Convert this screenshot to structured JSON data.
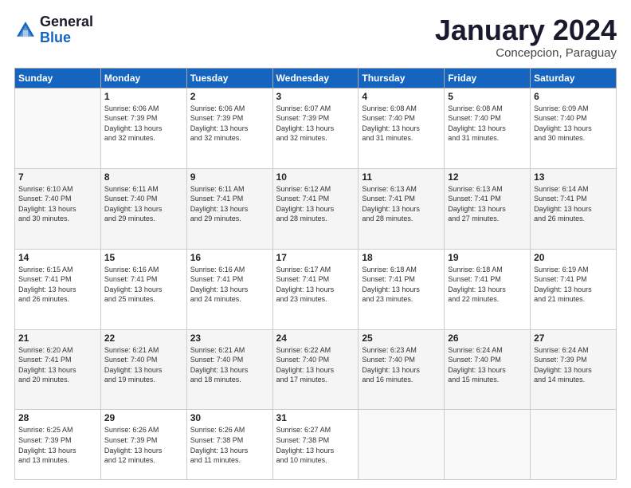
{
  "header": {
    "logo_general": "General",
    "logo_blue": "Blue",
    "title": "January 2024",
    "location": "Concepcion, Paraguay"
  },
  "days_header": [
    "Sunday",
    "Monday",
    "Tuesday",
    "Wednesday",
    "Thursday",
    "Friday",
    "Saturday"
  ],
  "weeks": [
    [
      {
        "day": "",
        "info": ""
      },
      {
        "day": "1",
        "info": "Sunrise: 6:06 AM\nSunset: 7:39 PM\nDaylight: 13 hours\nand 32 minutes."
      },
      {
        "day": "2",
        "info": "Sunrise: 6:06 AM\nSunset: 7:39 PM\nDaylight: 13 hours\nand 32 minutes."
      },
      {
        "day": "3",
        "info": "Sunrise: 6:07 AM\nSunset: 7:39 PM\nDaylight: 13 hours\nand 32 minutes."
      },
      {
        "day": "4",
        "info": "Sunrise: 6:08 AM\nSunset: 7:40 PM\nDaylight: 13 hours\nand 31 minutes."
      },
      {
        "day": "5",
        "info": "Sunrise: 6:08 AM\nSunset: 7:40 PM\nDaylight: 13 hours\nand 31 minutes."
      },
      {
        "day": "6",
        "info": "Sunrise: 6:09 AM\nSunset: 7:40 PM\nDaylight: 13 hours\nand 30 minutes."
      }
    ],
    [
      {
        "day": "7",
        "info": "Sunrise: 6:10 AM\nSunset: 7:40 PM\nDaylight: 13 hours\nand 30 minutes."
      },
      {
        "day": "8",
        "info": "Sunrise: 6:11 AM\nSunset: 7:40 PM\nDaylight: 13 hours\nand 29 minutes."
      },
      {
        "day": "9",
        "info": "Sunrise: 6:11 AM\nSunset: 7:41 PM\nDaylight: 13 hours\nand 29 minutes."
      },
      {
        "day": "10",
        "info": "Sunrise: 6:12 AM\nSunset: 7:41 PM\nDaylight: 13 hours\nand 28 minutes."
      },
      {
        "day": "11",
        "info": "Sunrise: 6:13 AM\nSunset: 7:41 PM\nDaylight: 13 hours\nand 28 minutes."
      },
      {
        "day": "12",
        "info": "Sunrise: 6:13 AM\nSunset: 7:41 PM\nDaylight: 13 hours\nand 27 minutes."
      },
      {
        "day": "13",
        "info": "Sunrise: 6:14 AM\nSunset: 7:41 PM\nDaylight: 13 hours\nand 26 minutes."
      }
    ],
    [
      {
        "day": "14",
        "info": "Sunrise: 6:15 AM\nSunset: 7:41 PM\nDaylight: 13 hours\nand 26 minutes."
      },
      {
        "day": "15",
        "info": "Sunrise: 6:16 AM\nSunset: 7:41 PM\nDaylight: 13 hours\nand 25 minutes."
      },
      {
        "day": "16",
        "info": "Sunrise: 6:16 AM\nSunset: 7:41 PM\nDaylight: 13 hours\nand 24 minutes."
      },
      {
        "day": "17",
        "info": "Sunrise: 6:17 AM\nSunset: 7:41 PM\nDaylight: 13 hours\nand 23 minutes."
      },
      {
        "day": "18",
        "info": "Sunrise: 6:18 AM\nSunset: 7:41 PM\nDaylight: 13 hours\nand 23 minutes."
      },
      {
        "day": "19",
        "info": "Sunrise: 6:18 AM\nSunset: 7:41 PM\nDaylight: 13 hours\nand 22 minutes."
      },
      {
        "day": "20",
        "info": "Sunrise: 6:19 AM\nSunset: 7:41 PM\nDaylight: 13 hours\nand 21 minutes."
      }
    ],
    [
      {
        "day": "21",
        "info": "Sunrise: 6:20 AM\nSunset: 7:41 PM\nDaylight: 13 hours\nand 20 minutes."
      },
      {
        "day": "22",
        "info": "Sunrise: 6:21 AM\nSunset: 7:40 PM\nDaylight: 13 hours\nand 19 minutes."
      },
      {
        "day": "23",
        "info": "Sunrise: 6:21 AM\nSunset: 7:40 PM\nDaylight: 13 hours\nand 18 minutes."
      },
      {
        "day": "24",
        "info": "Sunrise: 6:22 AM\nSunset: 7:40 PM\nDaylight: 13 hours\nand 17 minutes."
      },
      {
        "day": "25",
        "info": "Sunrise: 6:23 AM\nSunset: 7:40 PM\nDaylight: 13 hours\nand 16 minutes."
      },
      {
        "day": "26",
        "info": "Sunrise: 6:24 AM\nSunset: 7:40 PM\nDaylight: 13 hours\nand 15 minutes."
      },
      {
        "day": "27",
        "info": "Sunrise: 6:24 AM\nSunset: 7:39 PM\nDaylight: 13 hours\nand 14 minutes."
      }
    ],
    [
      {
        "day": "28",
        "info": "Sunrise: 6:25 AM\nSunset: 7:39 PM\nDaylight: 13 hours\nand 13 minutes."
      },
      {
        "day": "29",
        "info": "Sunrise: 6:26 AM\nSunset: 7:39 PM\nDaylight: 13 hours\nand 12 minutes."
      },
      {
        "day": "30",
        "info": "Sunrise: 6:26 AM\nSunset: 7:38 PM\nDaylight: 13 hours\nand 11 minutes."
      },
      {
        "day": "31",
        "info": "Sunrise: 6:27 AM\nSunset: 7:38 PM\nDaylight: 13 hours\nand 10 minutes."
      },
      {
        "day": "",
        "info": ""
      },
      {
        "day": "",
        "info": ""
      },
      {
        "day": "",
        "info": ""
      }
    ]
  ]
}
